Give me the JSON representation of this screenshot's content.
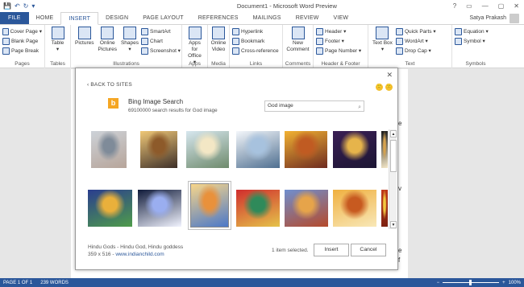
{
  "window": {
    "title": "Document1 - Microsoft Word Preview",
    "controls": [
      "?",
      "▭",
      "—",
      "▢",
      "✕"
    ]
  },
  "quick_access": {
    "icons": [
      "save-icon",
      "undo-icon",
      "redo-icon",
      "customize-icon"
    ],
    "glyphs": [
      "💾",
      "↶",
      "↻",
      "▾"
    ]
  },
  "tabs": [
    {
      "label": "FILE"
    },
    {
      "label": "HOME"
    },
    {
      "label": "INSERT",
      "active": true
    },
    {
      "label": "DESIGN"
    },
    {
      "label": "PAGE LAYOUT"
    },
    {
      "label": "REFERENCES"
    },
    {
      "label": "MAILINGS"
    },
    {
      "label": "REVIEW"
    },
    {
      "label": "VIEW"
    }
  ],
  "user": {
    "name": "Satya Prakash"
  },
  "ribbon": {
    "pages": {
      "label": "Pages",
      "items": [
        "Cover Page ▾",
        "Blank Page",
        "Page Break"
      ]
    },
    "tables": {
      "label": "Tables",
      "item": "Table",
      "caret": "▾"
    },
    "illustrations": {
      "label": "Illustrations",
      "pictures": "Pictures",
      "online_pictures": "Online Pictures",
      "shapes": "Shapes",
      "shapes_caret": "▾",
      "smartart": "SmartArt",
      "chart": "Chart",
      "screenshot": "Screenshot ▾"
    },
    "apps": {
      "label": "Apps",
      "item": "Apps for Office",
      "caret": "▾"
    },
    "media": {
      "label": "Media",
      "item": "Online Video"
    },
    "links": {
      "label": "Links",
      "items": [
        "Hyperlink",
        "Bookmark",
        "Cross-reference"
      ]
    },
    "comments": {
      "label": "Comments",
      "item": "New Comment"
    },
    "header_footer": {
      "label": "Header & Footer",
      "items": [
        "Header ▾",
        "Footer ▾",
        "Page Number ▾"
      ]
    },
    "text": {
      "label": "Text",
      "textbox": "Text Box",
      "textbox_caret": "▾",
      "items": [
        "Quick Parts ▾",
        "WordArt ▾",
        "Drop Cap ▾"
      ]
    },
    "symbols": {
      "label": "Symbols",
      "items": [
        "Equation ▾",
        "Symbol ▾"
      ]
    }
  },
  "dialog": {
    "back": "‹ BACK TO SITES",
    "close": "✕",
    "smileys": [
      "🙂",
      "🙁"
    ],
    "provider": {
      "logo": "b",
      "name": "Bing Image Search",
      "subtitle": "69100000 search results for God image"
    },
    "search": {
      "value": "God image",
      "icon": "⌕"
    },
    "images": [
      {
        "row": 0,
        "colors": [
          "#cdd2d8",
          "#7f8b99",
          "#b7a59a"
        ],
        "selected": false
      },
      {
        "row": 0,
        "colors": [
          "#f0c878",
          "#8d5a2a",
          "#3d2f28"
        ],
        "selected": false
      },
      {
        "row": 0,
        "colors": [
          "#d7e7ef",
          "#f3e7c5",
          "#6e8a6c"
        ],
        "selected": false
      },
      {
        "row": 0,
        "colors": [
          "#f4f7fb",
          "#a7c2de",
          "#4f6f90"
        ],
        "selected": false
      },
      {
        "row": 0,
        "colors": [
          "#f2b233",
          "#c05b22",
          "#6e2b20"
        ],
        "selected": false
      },
      {
        "row": 0,
        "colors": [
          "#3a1f55",
          "#e6b44b",
          "#1c1633"
        ],
        "selected": false
      },
      {
        "row": 0,
        "colors": [
          "#1a1a1a",
          "#d6a24e",
          "#f5e8c8"
        ],
        "selected": false
      },
      {
        "row": 1,
        "colors": [
          "#2a3d8f",
          "#e9b03b",
          "#4f9c4b"
        ],
        "selected": false
      },
      {
        "row": 1,
        "colors": [
          "#0f1a3a",
          "#9aaef0",
          "#f2f4ff"
        ],
        "selected": false
      },
      {
        "row": 1,
        "colors": [
          "#f8d68a",
          "#e9913b",
          "#4b78c8"
        ],
        "selected": true
      },
      {
        "row": 1,
        "colors": [
          "#d02d2d",
          "#2f8a5a",
          "#e5c34a"
        ],
        "selected": false
      },
      {
        "row": 1,
        "colors": [
          "#6f8fcf",
          "#e6a44a",
          "#b54a2b"
        ],
        "selected": false
      },
      {
        "row": 1,
        "colors": [
          "#f0b040",
          "#c75a20",
          "#f8e8b8"
        ],
        "selected": false
      },
      {
        "row": 1,
        "colors": [
          "#c23a1a",
          "#f2c840",
          "#7a2010"
        ],
        "selected": false
      }
    ],
    "scroll": {
      "up": "▲",
      "down": "▼"
    },
    "info": {
      "title": "Hindu Gods - Hindu God, Hindu goddess",
      "size": "359 x 516 -",
      "link": "www.indianchild.com"
    },
    "selection": "1 item selected.",
    "insert_button": "Insert",
    "cancel_button": "Cancel"
  },
  "page_marks": [
    "e",
    "v",
    "e",
    "f"
  ],
  "status": {
    "page": "PAGE 1 OF 1",
    "words": "239 WORDS",
    "zoom": "100%",
    "zoom_minus": "−",
    "zoom_plus": "+"
  }
}
